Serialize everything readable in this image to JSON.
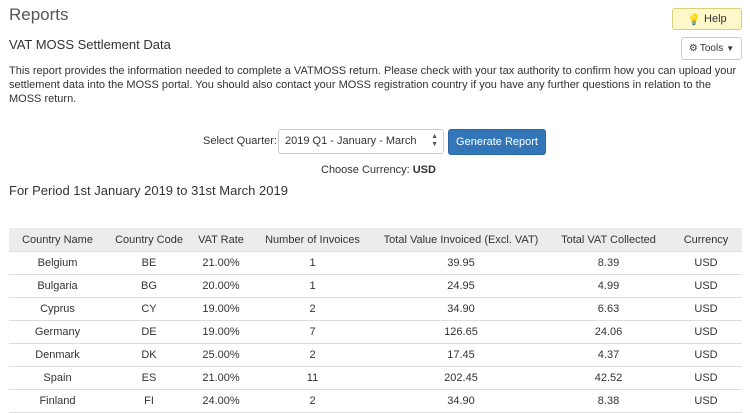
{
  "header": {
    "title": "Reports",
    "help_label": "Help",
    "tools_label": "Tools"
  },
  "report": {
    "subtitle": "VAT MOSS Settlement Data",
    "description": "This report provides the information needed to complete a VATMOSS return. Please check with your tax authority to confirm how you can upload your settlement data into the MOSS portal. You should also contact your MOSS registration country if you have any further questions in relation to the MOSS return."
  },
  "controls": {
    "quarter_label": "Select Quarter:",
    "quarter_selected": "2019 Q1 - January - March",
    "generate_label": "Generate Report",
    "currency_label": "Choose Currency:",
    "currency_value": "USD"
  },
  "period": {
    "title": "For Period 1st January 2019 to 31st March 2019"
  },
  "table": {
    "headers": [
      "Country Name",
      "Country Code",
      "VAT Rate",
      "Number of Invoices",
      "Total Value Invoiced (Excl. VAT)",
      "Total VAT Collected",
      "Currency"
    ],
    "rows": [
      [
        "Belgium",
        "BE",
        "21.00%",
        "1",
        "39.95",
        "8.39",
        "USD"
      ],
      [
        "Bulgaria",
        "BG",
        "20.00%",
        "1",
        "24.95",
        "4.99",
        "USD"
      ],
      [
        "Cyprus",
        "CY",
        "19.00%",
        "2",
        "34.90",
        "6.63",
        "USD"
      ],
      [
        "Germany",
        "DE",
        "19.00%",
        "7",
        "126.65",
        "24.06",
        "USD"
      ],
      [
        "Denmark",
        "DK",
        "25.00%",
        "2",
        "17.45",
        "4.37",
        "USD"
      ],
      [
        "Spain",
        "ES",
        "21.00%",
        "11",
        "202.45",
        "42.52",
        "USD"
      ],
      [
        "Finland",
        "FI",
        "24.00%",
        "2",
        "34.90",
        "8.38",
        "USD"
      ]
    ]
  },
  "icons": {
    "help": "lightbulb-icon",
    "tools": "cogs-icon",
    "tools_caret": "caret-down-icon",
    "select_arrows": "select-arrows-icon"
  },
  "colors": {
    "help_bg": "#fcf8c9",
    "primary_button": "#3276b8",
    "table_header_bg": "#ececec"
  }
}
